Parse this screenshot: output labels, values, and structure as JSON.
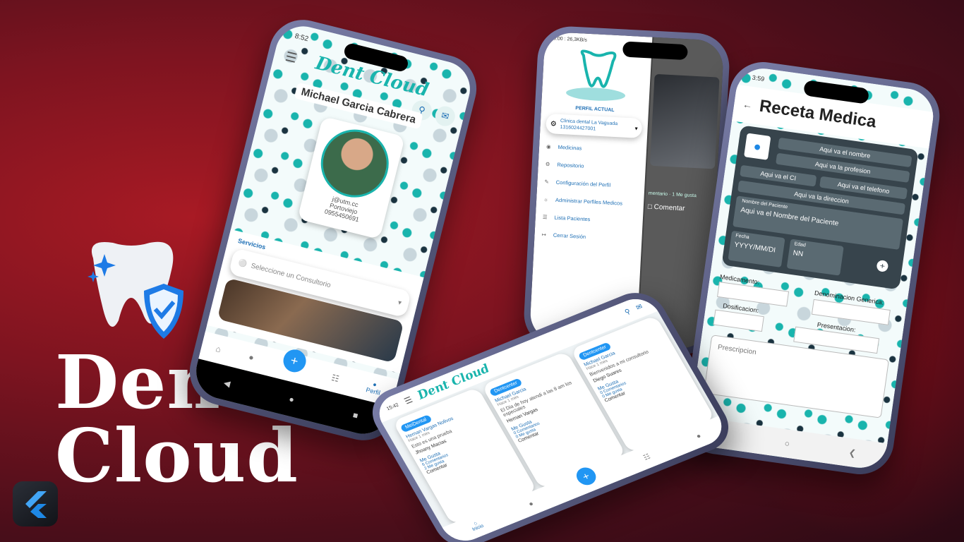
{
  "brand": {
    "line1": "Dent",
    "line2": "Cloud",
    "accent": "#19b4ad",
    "navy": "#1a3340"
  },
  "phone_profile": {
    "status_time": "8:52",
    "logo": "Dent Cloud",
    "name": "Michael Garcia Cabrera",
    "email": "j@utm.cc",
    "city": "Portoviejo",
    "phone": "0955450691",
    "services_label": "Servicios",
    "select_placeholder": "Seleccione un Consultorio",
    "profile_tab": "Perfil"
  },
  "phone_menu": {
    "status": "18:00 : 26,3KB/s",
    "current_profile_label": "PERFIL ACTUAL",
    "clinic_name": "Clinica dental La Vaguada",
    "clinic_id": "1316024427001",
    "items": [
      "Medicinas",
      "Repositorio",
      "Configuración del Perfil",
      "Administrar Perfiles Medicos",
      "Lista Pacientes",
      "Cerrar Sesión"
    ],
    "post_meta": "mentario · 1 Me gusta",
    "comment_label": "Comentar"
  },
  "phone_rx": {
    "status_time": "3:59",
    "title": "Receta Medica",
    "name_ph": "Aqui va el nombre",
    "profession_ph": "Aqui va la profesion",
    "ci_ph": "Aqui va el CI",
    "phone_ph": "Aqui va el telefono",
    "address_ph": "Aqui va la direccion",
    "patient_label": "Nombre del Paciente",
    "patient_ph": "Aqui va el Nombre del Paciente",
    "date_label": "Fecha",
    "date_ph": "YYYY/MM/DI",
    "age_label": "Edad",
    "age_ph": "NN",
    "medication_label": "Medicamento:",
    "generic_label": "Denominacion Generica:",
    "dose_label": "Dosificacion:",
    "presentation_label": "Presentacion:",
    "prescription_ph": "Prescripcion"
  },
  "phone_feed": {
    "status_time": "15:42",
    "logo": "Dent Cloud",
    "posts": [
      {
        "chip": "Dentcenter",
        "author": "Michael Garcia",
        "time": "Hace 1 mes",
        "text": "Bienvenidos a mi consultorio",
        "tag": "Diego Suares",
        "likes": "Me Gusta",
        "comments": "0 Comentarios",
        "likes_count": "0 Me gusta",
        "comment": "Comentar"
      },
      {
        "chip": "Dentcenter",
        "author": "Michael Garcia",
        "time": "Hace 1 mes",
        "text": "El Dia de hoy atendi a las 8 am los especiales",
        "tag": "Hernan Vargas",
        "likes": "Me Gusta",
        "comments": "0 Comentarios",
        "likes_count": "0 Me gusta",
        "comment": "Comentar"
      },
      {
        "chip": "MeiDental",
        "author": "Hernan Vargas Nolivos",
        "time": "Hace 1 mes",
        "text": "Esto es una prueba",
        "tag": "Jhoany Macias",
        "likes": "Me Gusta",
        "comments": "6 Comentarios",
        "likes_count": "2 Me gusta",
        "comment": "Comentar"
      }
    ],
    "home_tab": "Inicio"
  }
}
